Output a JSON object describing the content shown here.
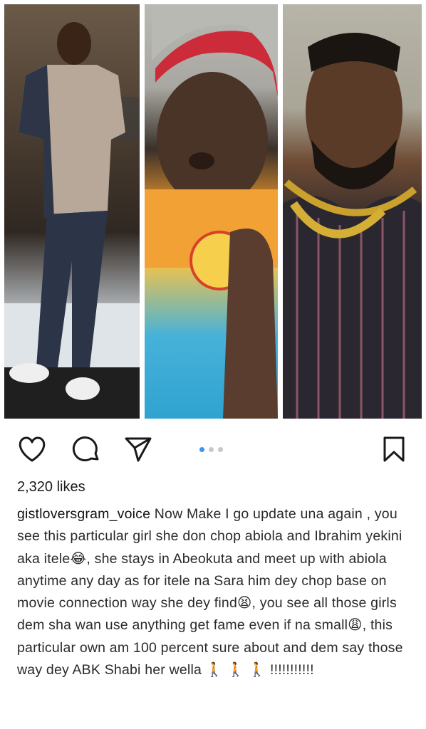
{
  "post": {
    "likes_text": "2,320 likes",
    "username": "gistloversgram_voice",
    "caption": " Now Make I go update una again , you see this particular girl she don chop abiola and Ibrahim yekini aka itele😂, she stays in Abeokuta and meet up with abiola anytime any day as for itele na Sara him dey chop base on movie connection way she dey find😫, you see all those girls dem sha wan use anything get fame even if na small😩, this particular own am 100 percent sure about and dem say those way dey ABK Shabi her wella 🚶 🚶 🚶 !!!!!!!!!!!"
  },
  "carousel": {
    "count": 3,
    "active_index": 0
  },
  "icons": [
    "heart-icon",
    "comment-icon",
    "share-icon",
    "bookmark-icon"
  ],
  "colors": {
    "active_dot": "#3897f0",
    "inactive_dot": "#c7c7c7"
  }
}
